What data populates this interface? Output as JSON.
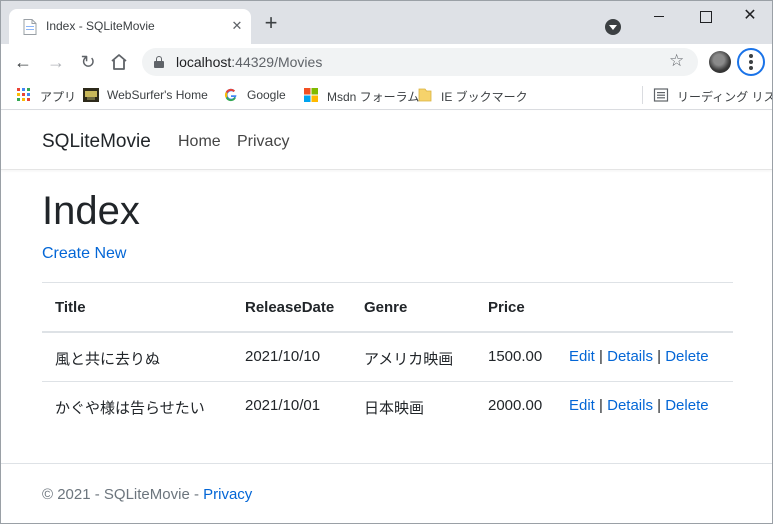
{
  "browser": {
    "tab_title": "Index - SQLiteMovie",
    "url_host": "localhost",
    "url_rest": ":44329/Movies",
    "bookmarks": [
      {
        "label": "アプリ",
        "icon": "apps-grid-icon"
      },
      {
        "label": "WebSurfer's Home",
        "icon": "websurfer-favicon"
      },
      {
        "label": "Google",
        "icon": "google-g-icon"
      },
      {
        "label": "Msdn フォーラム",
        "icon": "microsoft-logo-icon"
      },
      {
        "label": "IE ブックマーク",
        "icon": "folder-icon"
      },
      {
        "label": "リーディング リスト",
        "icon": "reading-list-icon"
      }
    ]
  },
  "navbar": {
    "brand": "SQLiteMovie",
    "links": [
      "Home",
      "Privacy"
    ]
  },
  "main": {
    "heading": "Index",
    "create_new": "Create New",
    "table": {
      "headers": [
        "Title",
        "ReleaseDate",
        "Genre",
        "Price"
      ],
      "rows": [
        {
          "title": "風と共に去りぬ",
          "release_date": "2021/10/10",
          "genre": "アメリカ映画",
          "price": "1500.00"
        },
        {
          "title": "かぐや様は告らせたい",
          "release_date": "2021/10/01",
          "genre": "日本映画",
          "price": "2000.00"
        }
      ],
      "actions": {
        "edit": "Edit",
        "details": "Details",
        "delete": "Delete",
        "separator": "|"
      }
    }
  },
  "footer": {
    "copyright": "© 2021 - SQLiteMovie - ",
    "privacy": "Privacy"
  },
  "colors": {
    "link": "#0366d6",
    "tabstrip": "#dee1e6",
    "omnibox": "#f1f3f4",
    "focus_ring": "#1a73e8"
  }
}
